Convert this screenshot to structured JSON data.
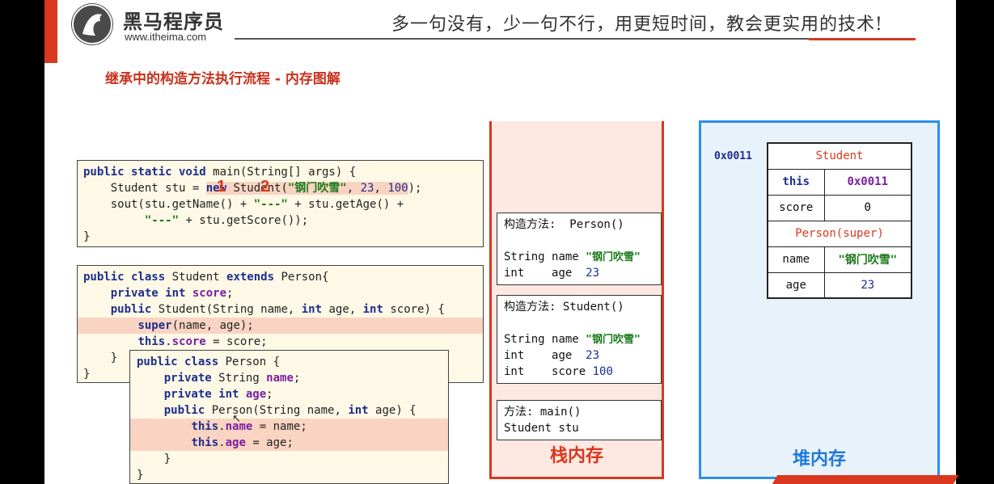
{
  "header": {
    "brand_name": "黑马程序员",
    "brand_url": "www.itheima.com",
    "slogan": "多一句没有，少一句不行，用更短时间，教会更实用的技术!"
  },
  "slide_title": "继承中的构造方法执行流程 - 内存图解",
  "code_main": {
    "line1": "public static void main(String[] args) {",
    "line2": "    Student stu = new Student(\"钢门吹雪\", 23, 100);",
    "line3": "    sout(stu.getName() + \"---\" + stu.getAge() +",
    "line4": "         \"---\" + stu.getScore());",
    "line5": "}"
  },
  "code_student": {
    "line1": "public class Student extends Person{",
    "line2": "    private int score;",
    "line3": "    public Student(String name, int age, int score) {",
    "line4": "        super(name, age);",
    "line5": "        this.score = score;",
    "line6": "    }",
    "line7": "}"
  },
  "code_person": {
    "line1": "public class Person {",
    "line2": "    private String name;",
    "line3": "    private int age;",
    "line4": "    public Person(String name, int age) {",
    "line5": "        this.name = name;",
    "line6": "        this.age = age;",
    "line7": "    }",
    "line8": "}"
  },
  "step_markers": [
    "1",
    "2"
  ],
  "stack": {
    "label": "栈内存",
    "frames": [
      {
        "title": "构造方法:  Person()",
        "vars": [
          {
            "type": "String",
            "name": "name",
            "value": "\"钢门吹雪\""
          },
          {
            "type": "int   ",
            "name": "age ",
            "value": "23"
          }
        ]
      },
      {
        "title": "构造方法: Student()",
        "vars": [
          {
            "type": "String",
            "name": "name ",
            "value": "\"钢门吹雪\""
          },
          {
            "type": "int   ",
            "name": "age  ",
            "value": "23"
          },
          {
            "type": "int   ",
            "name": "score",
            "value": "100"
          }
        ]
      },
      {
        "title": "方法: main()",
        "vars": [
          {
            "type": "Student",
            "name": "stu",
            "value": ""
          }
        ]
      }
    ]
  },
  "heap": {
    "label": "堆内存",
    "address": "0x0011",
    "object": {
      "class_name": "Student",
      "this_key": "this",
      "this_value": "0x0011",
      "score_key": "score",
      "score_value": "0",
      "super_header": "Person(super)",
      "name_key": "name",
      "name_value": "\"钢门吹雪\"",
      "age_key": "age",
      "age_value": "23"
    }
  },
  "colors": {
    "accent_red": "#d9381e",
    "heap_blue": "#2b8fe8",
    "keyword": "#1e2e8c",
    "string": "#1a7a1a",
    "field": "#7b1fa2"
  }
}
